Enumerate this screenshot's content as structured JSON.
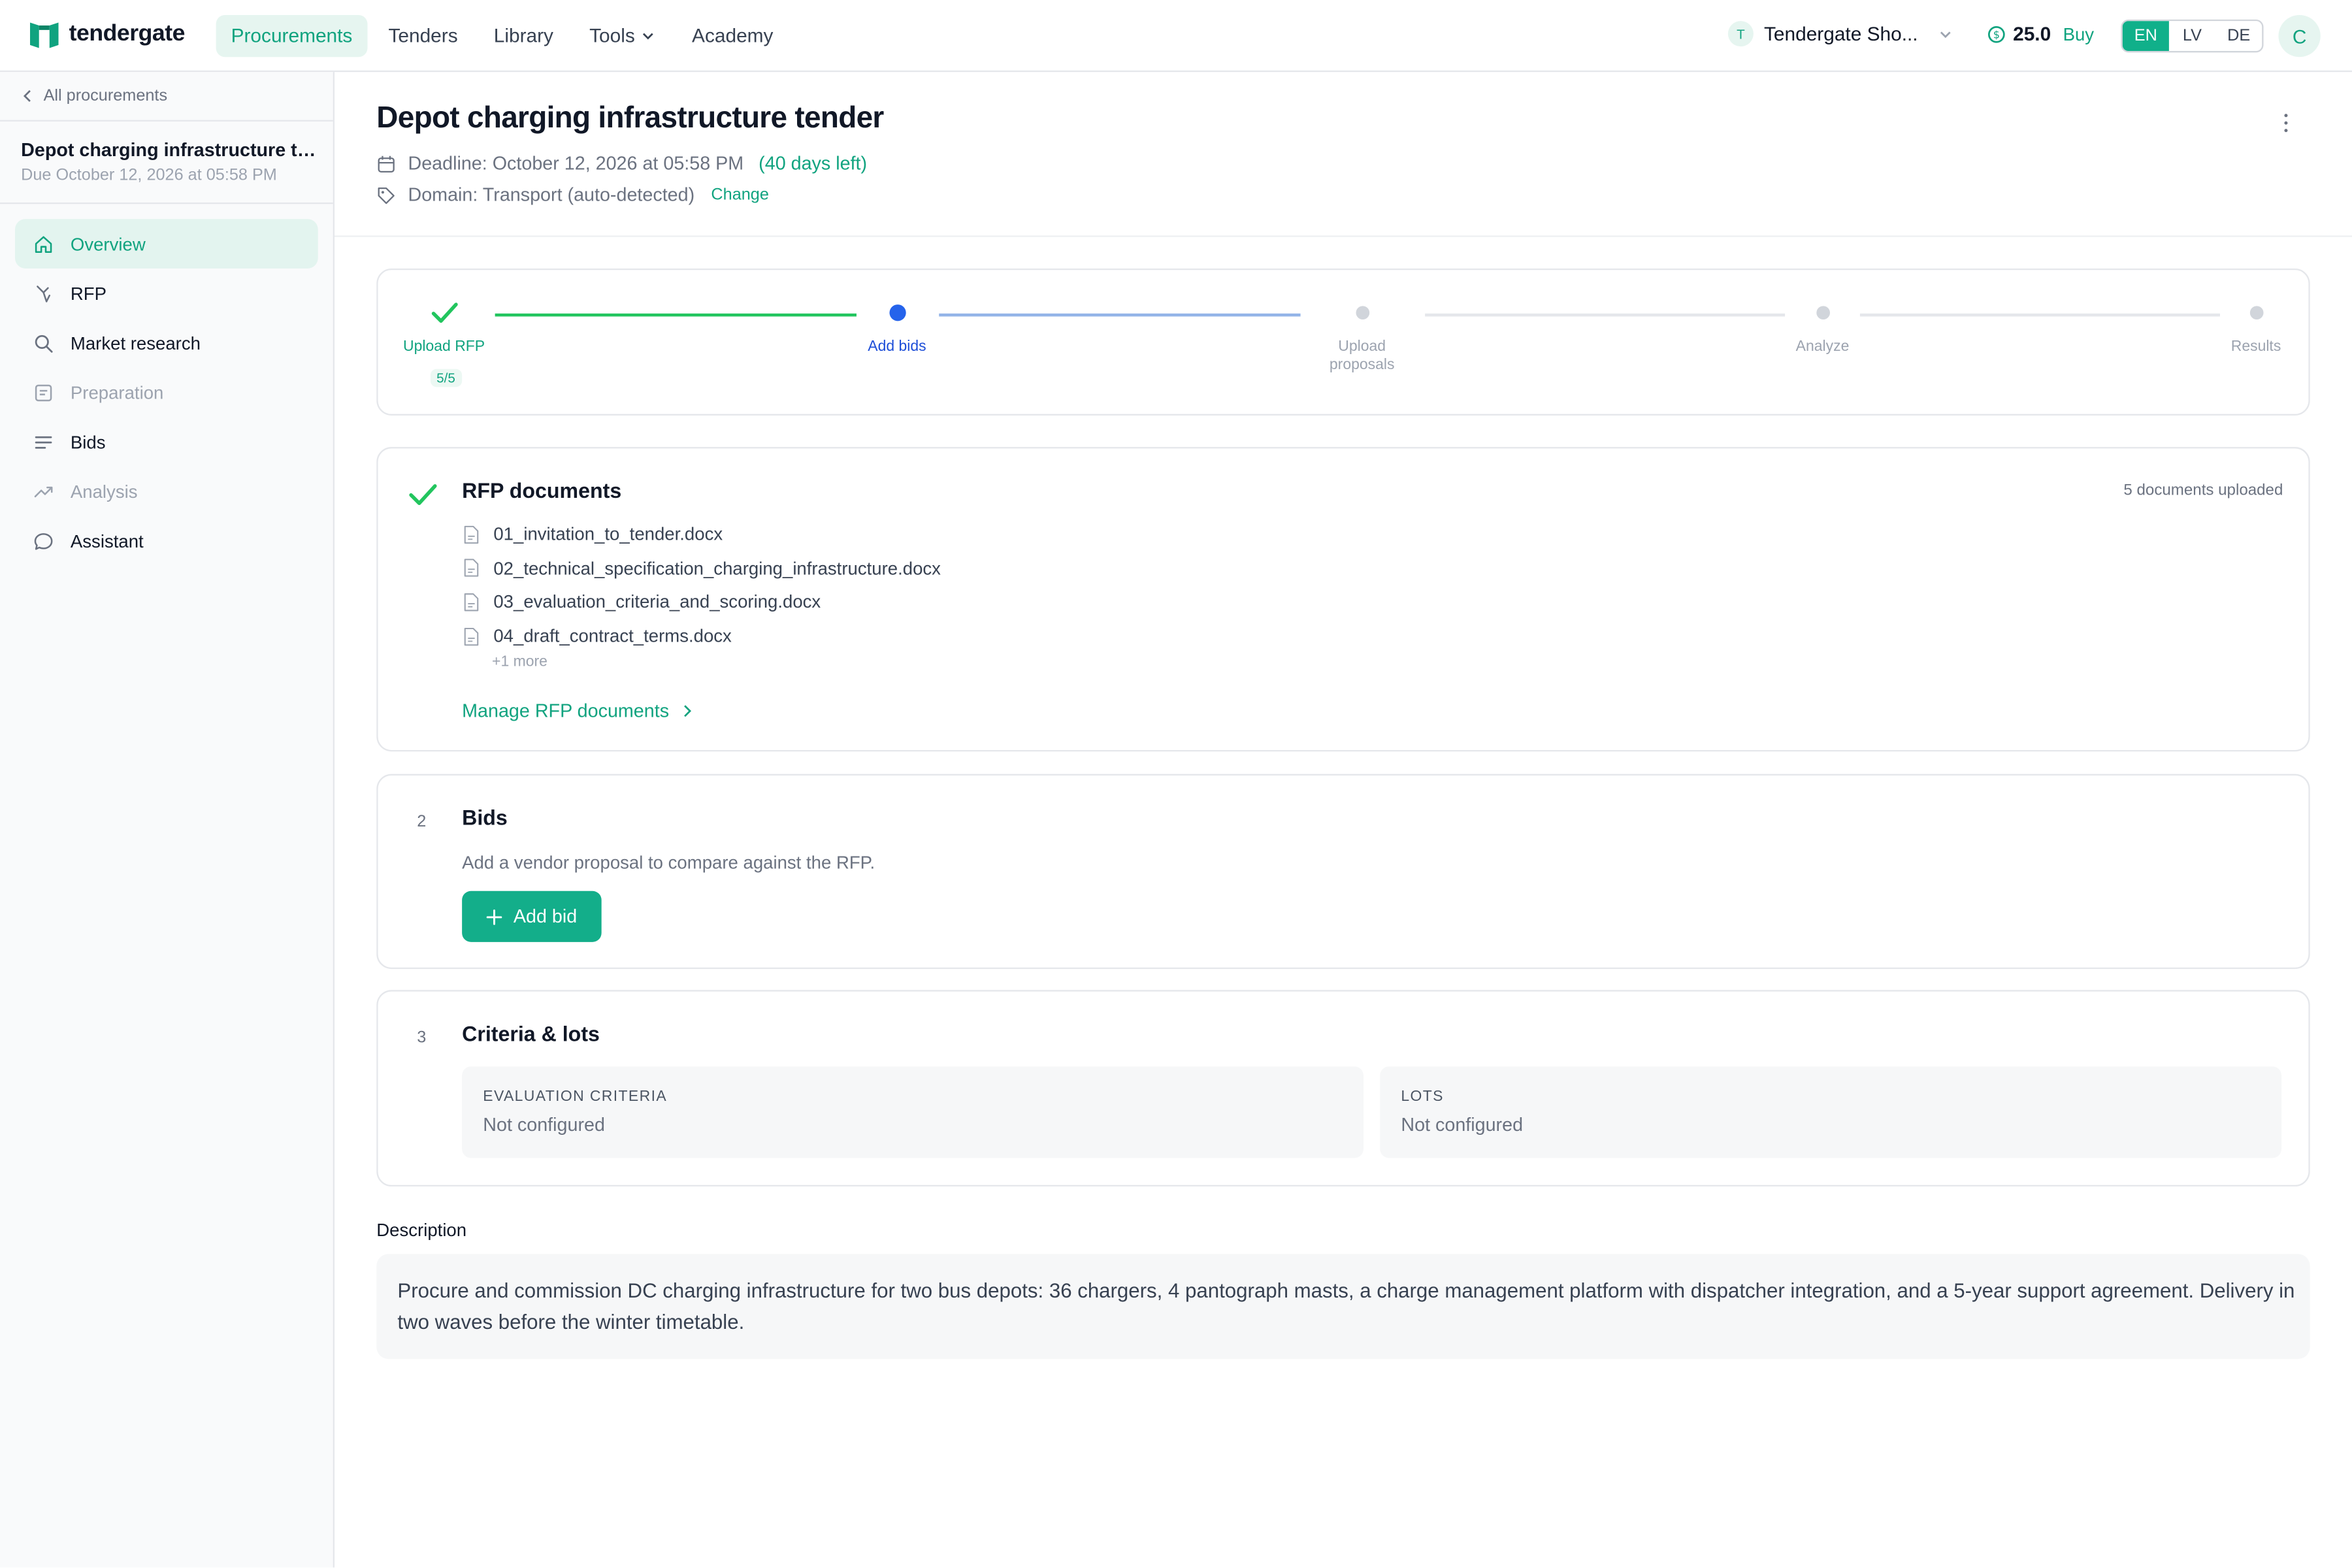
{
  "app": {
    "brand": "tendergate",
    "colors": {
      "accent": "#10a37f",
      "accent_bg": "#e6f5f0",
      "blue": "#2563eb"
    }
  },
  "topnav": {
    "items": [
      {
        "label": "Procurements",
        "active": true
      },
      {
        "label": "Tenders"
      },
      {
        "label": "Library"
      },
      {
        "label": "Tools",
        "has_dropdown": true
      },
      {
        "label": "Academy"
      }
    ]
  },
  "org": {
    "initial": "T",
    "name": "Tendergate Sho..."
  },
  "credits": {
    "value": "25.0",
    "buy_label": "Buy"
  },
  "languages": [
    {
      "label": "EN",
      "active": true
    },
    {
      "label": "LV"
    },
    {
      "label": "DE"
    }
  ],
  "user": {
    "initial": "C"
  },
  "sidebar": {
    "back_label": "All procurements",
    "title": "Depot charging infrastructure tender",
    "due": "Due October 12, 2026 at 05:58 PM",
    "items": [
      {
        "label": "Overview",
        "icon": "home-icon",
        "active": true
      },
      {
        "label": "RFP",
        "icon": "pen-icon"
      },
      {
        "label": "Market research",
        "icon": "search-icon"
      },
      {
        "label": "Preparation",
        "icon": "document-icon",
        "muted": true
      },
      {
        "label": "Bids",
        "icon": "list-icon"
      },
      {
        "label": "Analysis",
        "icon": "trend-icon",
        "muted": true
      },
      {
        "label": "Assistant",
        "icon": "chat-icon"
      }
    ]
  },
  "page": {
    "title": "Depot charging infrastructure tender",
    "deadline": "Deadline: October 12, 2026 at 05:58 PM",
    "days_left": "(40 days left)",
    "domain": "Domain: Transport (auto-detected)",
    "change_label": "Change"
  },
  "stepper": {
    "steps": [
      {
        "label": "Upload RFP",
        "status": "done",
        "badge": "5/5"
      },
      {
        "label": "Add bids",
        "status": "current"
      },
      {
        "label": "Upload\nproposals",
        "status": "pending"
      },
      {
        "label": "Analyze",
        "status": "pending"
      },
      {
        "label": "Results",
        "status": "pending"
      }
    ]
  },
  "rfp": {
    "title": "RFP documents",
    "count_label": "5 documents uploaded",
    "documents": [
      "01_invitation_to_tender.docx",
      "02_technical_specification_charging_infrastructure.docx",
      "03_evaluation_criteria_and_scoring.docx",
      "04_draft_contract_terms.docx"
    ],
    "more_label": "+1 more",
    "manage_label": "Manage RFP documents"
  },
  "bids": {
    "number": "2",
    "title": "Bids",
    "subtitle": "Add a vendor proposal to compare against the RFP.",
    "add_label": "Add bid"
  },
  "criteria": {
    "number": "3",
    "title": "Criteria & lots",
    "boxes": [
      {
        "label": "Evaluation criteria",
        "value": "Not configured"
      },
      {
        "label": "Lots",
        "value": "Not configured"
      }
    ]
  },
  "description": {
    "label": "Description",
    "text": "Procure and commission DC charging infrastructure for two bus depots: 36 chargers, 4 pantograph masts, a charge management platform with dispatcher integration, and a 5-year support agreement. Delivery in two waves before the winter timetable."
  }
}
